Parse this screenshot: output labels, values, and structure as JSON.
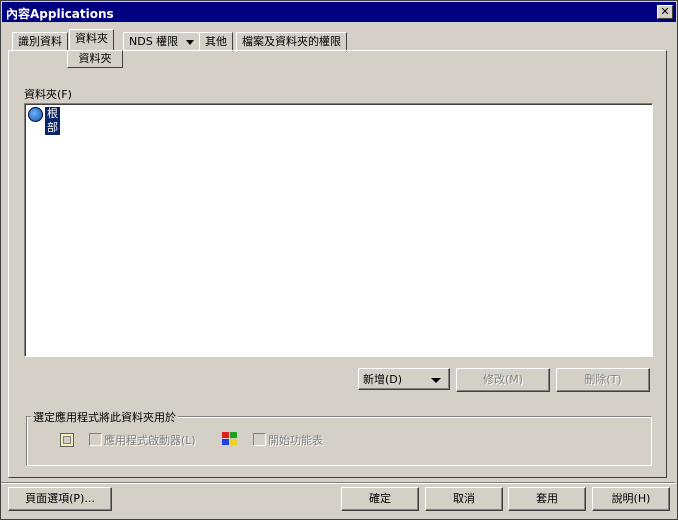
{
  "window": {
    "title": "內容Applications",
    "close_symbol": "✕"
  },
  "tabs": [
    {
      "label": "識別資料"
    },
    {
      "label": "資料夾"
    },
    {
      "label": "NDS 權限"
    },
    {
      "label": "其他"
    },
    {
      "label": "檔案及資料夾的權限"
    }
  ],
  "subtab": {
    "label": "資料夾"
  },
  "folder_section": {
    "label": "資料夾(F)",
    "tree": [
      {
        "label": "根部",
        "icon": "globe-icon",
        "selected": true
      }
    ]
  },
  "list_buttons": {
    "add": "新增(D)",
    "modify": "修改(M)",
    "delete": "刪除(T)"
  },
  "apply_group": {
    "legend": "選定應用程式將此資料夾用於",
    "launcher_label": "應用程式啟動器(L)",
    "start_menu_label": "開始功能表"
  },
  "footer": {
    "page_options": "頁面選項(P)...",
    "ok": "確定",
    "cancel": "取消",
    "apply": "套用",
    "help": "說明(H)"
  }
}
